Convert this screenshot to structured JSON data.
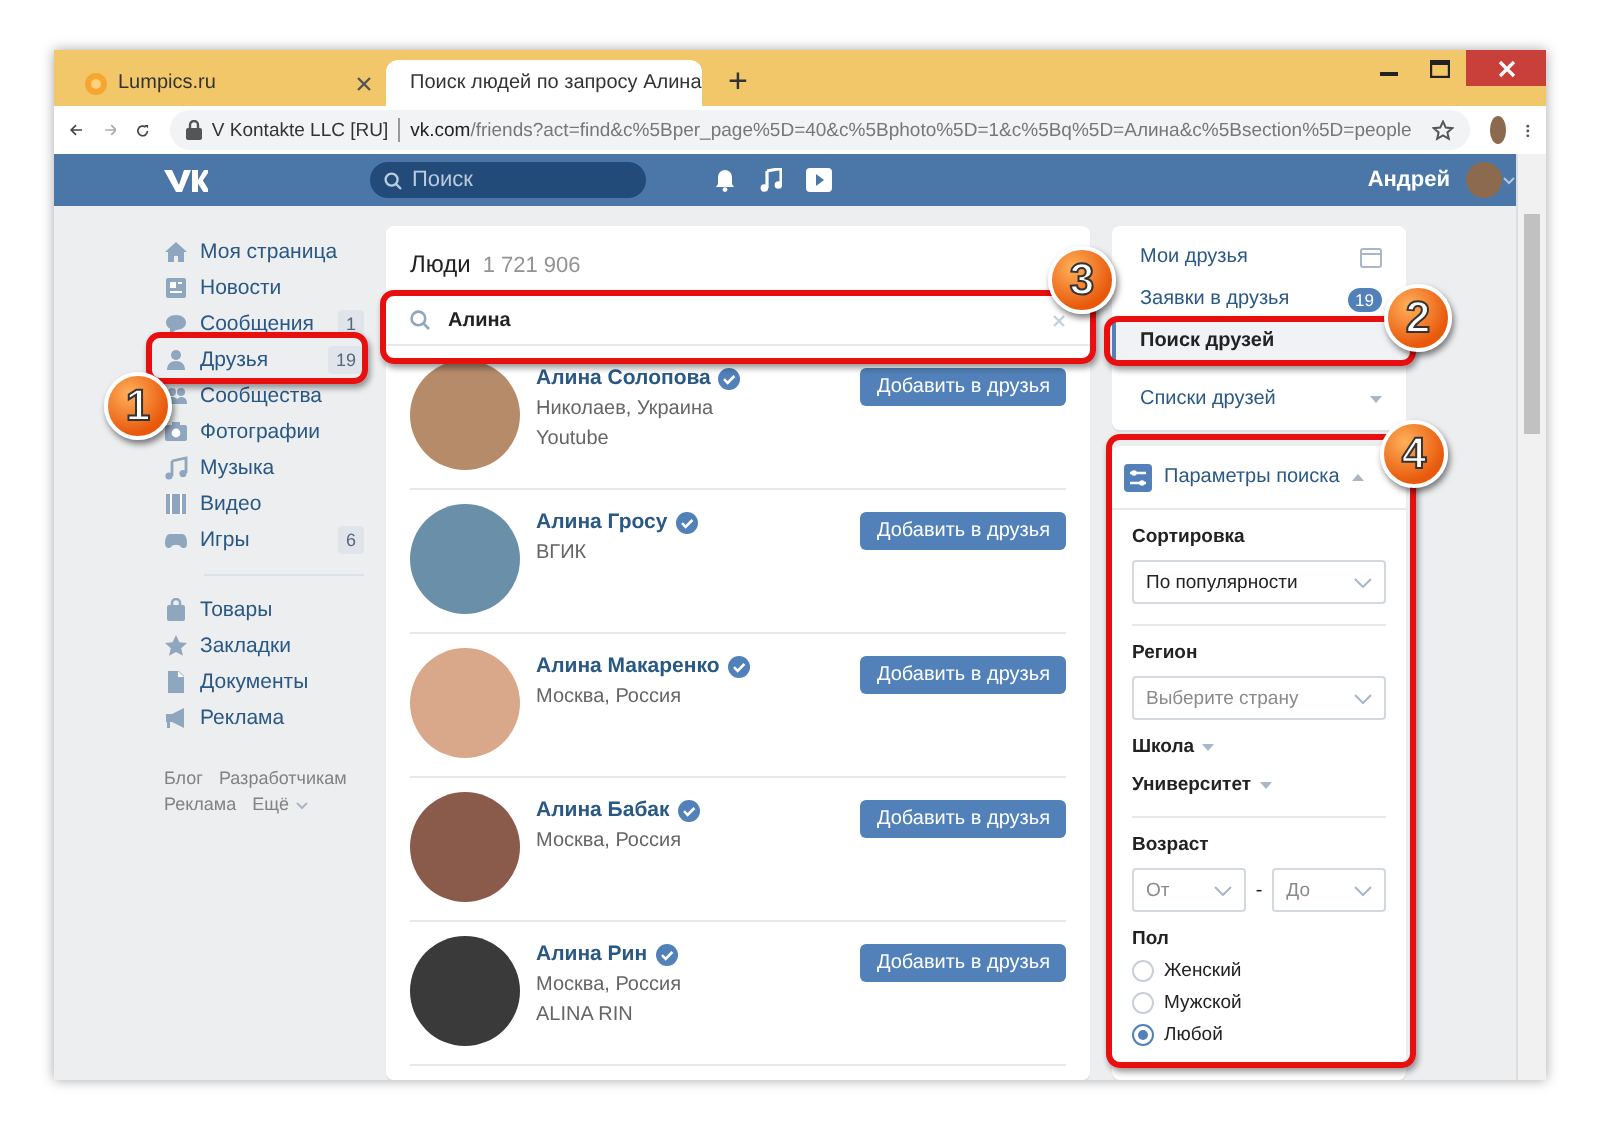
{
  "browser": {
    "tabs": [
      {
        "title": "Lumpics.ru",
        "kind": "site",
        "selected": false
      },
      {
        "title": "Поиск людей по запросу Алина",
        "kind": "vk",
        "selected": true
      }
    ],
    "new_tab": "+",
    "site_label": "V Kontakte LLC [RU]",
    "url_host": "vk.com",
    "url_path": "/friends?act=find&c%5Bper_page%5D=40&c%5Bphoto%5D=1&c%5Bq%5D=Алина&c%5Bsection%5D=people"
  },
  "header": {
    "search_placeholder": "Поиск",
    "user_name": "Андрей"
  },
  "sidebar": {
    "groups": [
      [
        {
          "label": "Моя страница"
        },
        {
          "label": "Новости"
        },
        {
          "label": "Сообщения",
          "badge": "1"
        },
        {
          "label": "Друзья",
          "badge": "19"
        },
        {
          "label": "Сообщества"
        },
        {
          "label": "Фотографии"
        },
        {
          "label": "Музыка"
        },
        {
          "label": "Видео"
        },
        {
          "label": "Игры",
          "badge": "6"
        }
      ],
      [
        {
          "label": "Товары"
        },
        {
          "label": "Закладки"
        },
        {
          "label": "Документы"
        },
        {
          "label": "Реклама"
        }
      ]
    ],
    "footer_links": [
      "Блог",
      "Разработчикам",
      "Реклама",
      "Ещё"
    ]
  },
  "people": {
    "title": "Люди",
    "count": "1 721 906",
    "search_value": "Алина",
    "results": [
      {
        "name": "Алина Солопова",
        "verified": true,
        "lines": [
          "Николаев, Украина",
          "Youtube"
        ],
        "button": "Добавить в друзья"
      },
      {
        "name": "Алина Гросу",
        "verified": true,
        "lines": [
          "ВГИК"
        ],
        "button": "Добавить в друзья"
      },
      {
        "name": "Алина Макаренко",
        "verified": true,
        "lines": [
          "Москва, Россия"
        ],
        "button": "Добавить в друзья"
      },
      {
        "name": "Алина Бабак",
        "verified": true,
        "lines": [
          "Москва, Россия"
        ],
        "button": "Добавить в друзья"
      },
      {
        "name": "Алина Рин",
        "verified": true,
        "lines": [
          "Москва, Россия",
          "ALINA RIN"
        ],
        "button": "Добавить в друзья"
      }
    ]
  },
  "friends_menu": {
    "items": [
      {
        "label": "Мои друзья",
        "kind": "calendar",
        "selected": false
      },
      {
        "label": "Заявки в друзья",
        "kind": "badge",
        "badge": "19",
        "selected": false
      },
      {
        "label": "Поиск друзей",
        "kind": "link",
        "selected": true
      },
      {
        "label": "Списки друзей",
        "kind": "dropdown",
        "selected": false
      }
    ]
  },
  "filters": {
    "title": "Параметры поиска",
    "sections": [
      {
        "kind": "select",
        "label": "Сортировка",
        "value": "По популярности"
      },
      {
        "kind": "divider"
      },
      {
        "kind": "select",
        "label": "Регион",
        "placeholder": "Выберите страну"
      },
      {
        "kind": "expander",
        "label": "Школа"
      },
      {
        "kind": "expander",
        "label": "Университет"
      },
      {
        "kind": "divider"
      },
      {
        "kind": "range",
        "label": "Возраст",
        "from_placeholder": "От",
        "separator": "-",
        "to_placeholder": "До"
      },
      {
        "kind": "radio",
        "label": "Пол",
        "options": [
          {
            "label": "Женский",
            "selected": false
          },
          {
            "label": "Мужской",
            "selected": false
          },
          {
            "label": "Любой",
            "selected": true
          }
        ]
      }
    ]
  },
  "annotations": [
    {
      "label": "1"
    },
    {
      "label": "2"
    },
    {
      "label": "3"
    },
    {
      "label": "4"
    }
  ]
}
